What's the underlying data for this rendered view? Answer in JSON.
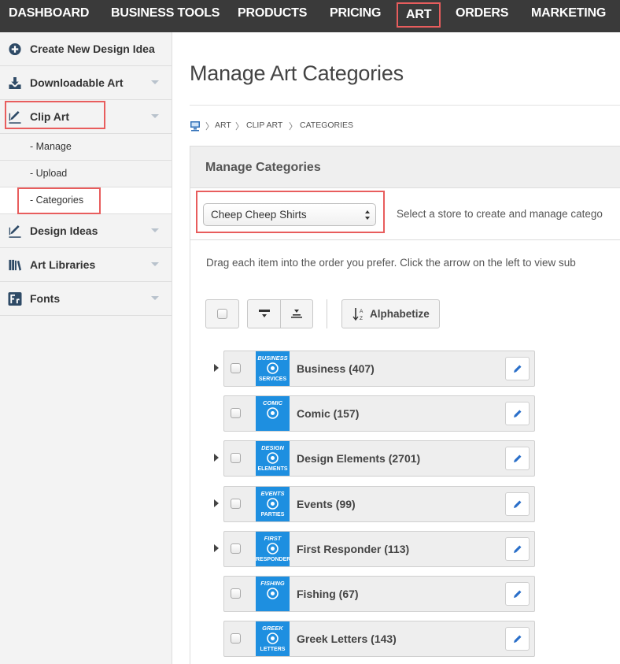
{
  "topnav": {
    "items": [
      {
        "label": "DASHBOARD"
      },
      {
        "label": "BUSINESS TOOLS"
      },
      {
        "label": "PRODUCTS"
      },
      {
        "label": "PRICING"
      },
      {
        "label": "ART",
        "active": true
      },
      {
        "label": "ORDERS"
      },
      {
        "label": "MARKETING"
      }
    ],
    "bg_color": "#3a3a3a",
    "highlight_color": "#e85d5d"
  },
  "sidebar": {
    "items": [
      {
        "label": "Create New Design Idea",
        "icon": "plus-circle-icon"
      },
      {
        "label": "Downloadable Art",
        "icon": "download-icon"
      },
      {
        "label": "Clip Art",
        "icon": "pen-icon",
        "highlighted": true
      },
      {
        "label": "Design Ideas",
        "icon": "pen-icon"
      },
      {
        "label": "Art Libraries",
        "icon": "books-icon"
      },
      {
        "label": "Fonts",
        "icon": "font-icon"
      }
    ],
    "clipart_sub": [
      {
        "label": "- Manage"
      },
      {
        "label": "- Upload"
      },
      {
        "label": "- Categories",
        "active": true
      }
    ]
  },
  "main": {
    "title": "Manage Art Categories",
    "breadcrumb": [
      "ART",
      "CLIP ART",
      "CATEGORIES"
    ],
    "panel_title": "Manage Categories",
    "store_select_value": "Cheep Cheep Shirts",
    "store_help": "Select a store to create and manage catego",
    "instructions": "Drag each item into the order you prefer. Click the arrow on the left to view sub",
    "alphabetize_label": "Alphabetize"
  },
  "categories": [
    {
      "name": "Business (407)",
      "thumb_top": "BUSINESS",
      "thumb_bottom": "SERVICES",
      "has_children": true
    },
    {
      "name": "Comic (157)",
      "thumb_top": "COMIC",
      "thumb_bottom": "",
      "has_children": false
    },
    {
      "name": "Design Elements (2701)",
      "thumb_top": "DESIGN",
      "thumb_bottom": "ELEMENTS",
      "has_children": true
    },
    {
      "name": "Events (99)",
      "thumb_top": "EVENTS",
      "thumb_bottom": "PARTIES",
      "has_children": true
    },
    {
      "name": "First Responder (113)",
      "thumb_top": "FIRST",
      "thumb_bottom": "RESPONDER",
      "has_children": true
    },
    {
      "name": "Fishing (67)",
      "thumb_top": "FISHING",
      "thumb_bottom": "",
      "has_children": false
    },
    {
      "name": "Greek Letters (143)",
      "thumb_top": "GREEK",
      "thumb_bottom": "LETTERS",
      "has_children": false
    }
  ],
  "colors": {
    "thumb_blue": "#1e8fe0",
    "edit_blue": "#2a6fc9"
  }
}
